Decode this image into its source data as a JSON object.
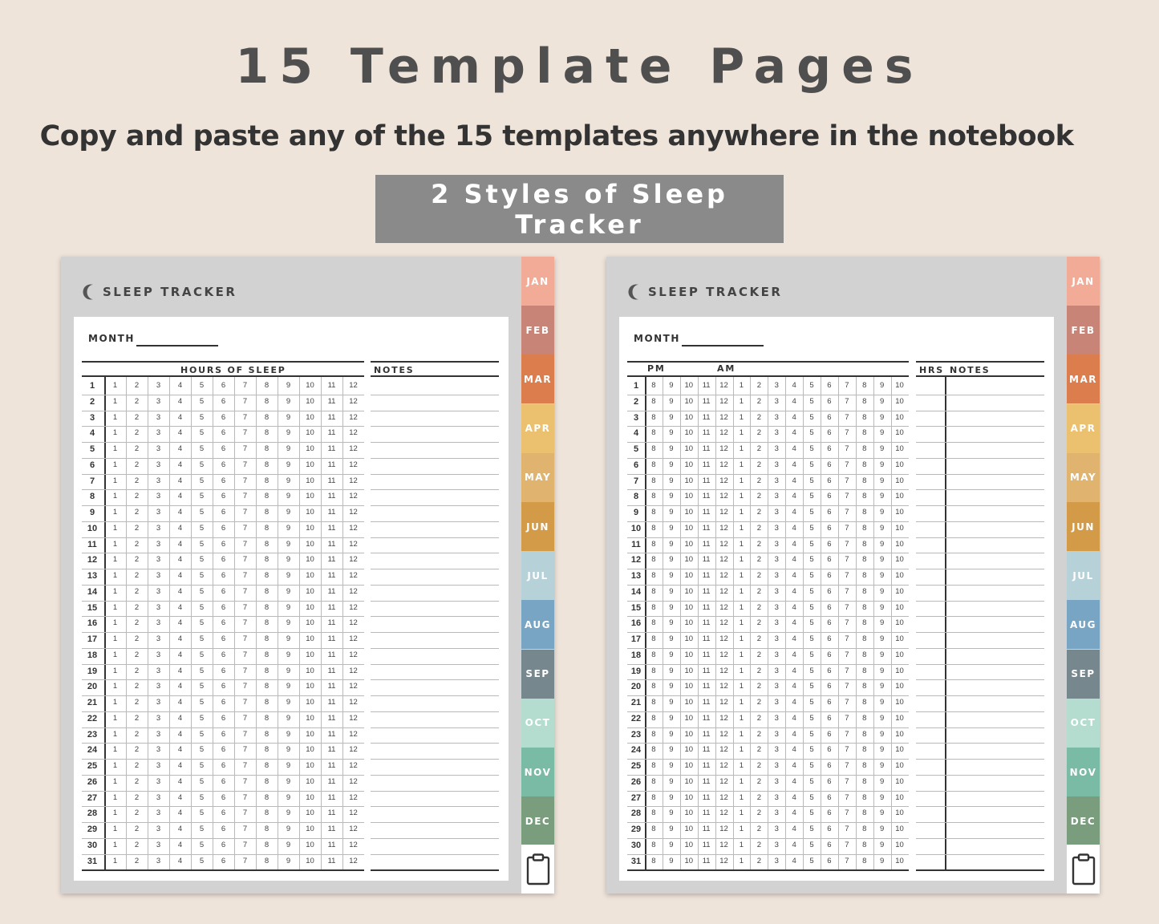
{
  "header": {
    "title": "15 Template Pages",
    "subtitle": "Copy and paste any of the 15 templates anywhere in the notebook",
    "badge": "2 Styles of Sleep Tracker"
  },
  "colors": {
    "background": "#efe4da",
    "notebook_frame": "#d2d2d2",
    "badge": "#8a8a8a"
  },
  "tabs": [
    {
      "label": "JAN",
      "color": "#f2ab96"
    },
    {
      "label": "FEB",
      "color": "#c98478"
    },
    {
      "label": "MAR",
      "color": "#dc7d4e"
    },
    {
      "label": "APR",
      "color": "#ebc06e"
    },
    {
      "label": "MAY",
      "color": "#e0b46e"
    },
    {
      "label": "JUN",
      "color": "#d39b48"
    },
    {
      "label": "JUL",
      "color": "#b7d1d8"
    },
    {
      "label": "AUG",
      "color": "#77a5c3"
    },
    {
      "label": "SEP",
      "color": "#77878e"
    },
    {
      "label": "OCT",
      "color": "#b4dccf"
    },
    {
      "label": "NOV",
      "color": "#79bba5"
    },
    {
      "label": "DEC",
      "color": "#7a9d7e"
    }
  ],
  "clipboard_icon": "clipboard-icon",
  "moon_icon": "crescent-moon-icon",
  "left_tracker": {
    "title": "SLEEP TRACKER",
    "month_label": "MONTH",
    "hours_header": "HOURS OF SLEEP",
    "notes_header": "NOTES",
    "hours": [
      "1",
      "2",
      "3",
      "4",
      "5",
      "6",
      "7",
      "8",
      "9",
      "10",
      "11",
      "12"
    ],
    "days": [
      "1",
      "2",
      "3",
      "4",
      "5",
      "6",
      "7",
      "8",
      "9",
      "10",
      "11",
      "12",
      "13",
      "14",
      "15",
      "16",
      "17",
      "18",
      "19",
      "20",
      "21",
      "22",
      "23",
      "24",
      "25",
      "26",
      "27",
      "28",
      "29",
      "30",
      "31"
    ]
  },
  "right_tracker": {
    "title": "SLEEP TRACKER",
    "month_label": "MONTH",
    "pm_header": "PM",
    "am_header": "AM",
    "hrs_header": "HRS",
    "notes_header": "NOTES",
    "times": [
      "8",
      "9",
      "10",
      "11",
      "12",
      "1",
      "2",
      "3",
      "4",
      "5",
      "6",
      "7",
      "8",
      "9",
      "10"
    ],
    "days": [
      "1",
      "2",
      "3",
      "4",
      "5",
      "6",
      "7",
      "8",
      "9",
      "10",
      "11",
      "12",
      "13",
      "14",
      "15",
      "16",
      "17",
      "18",
      "19",
      "20",
      "21",
      "22",
      "23",
      "24",
      "25",
      "26",
      "27",
      "28",
      "29",
      "30",
      "31"
    ]
  }
}
